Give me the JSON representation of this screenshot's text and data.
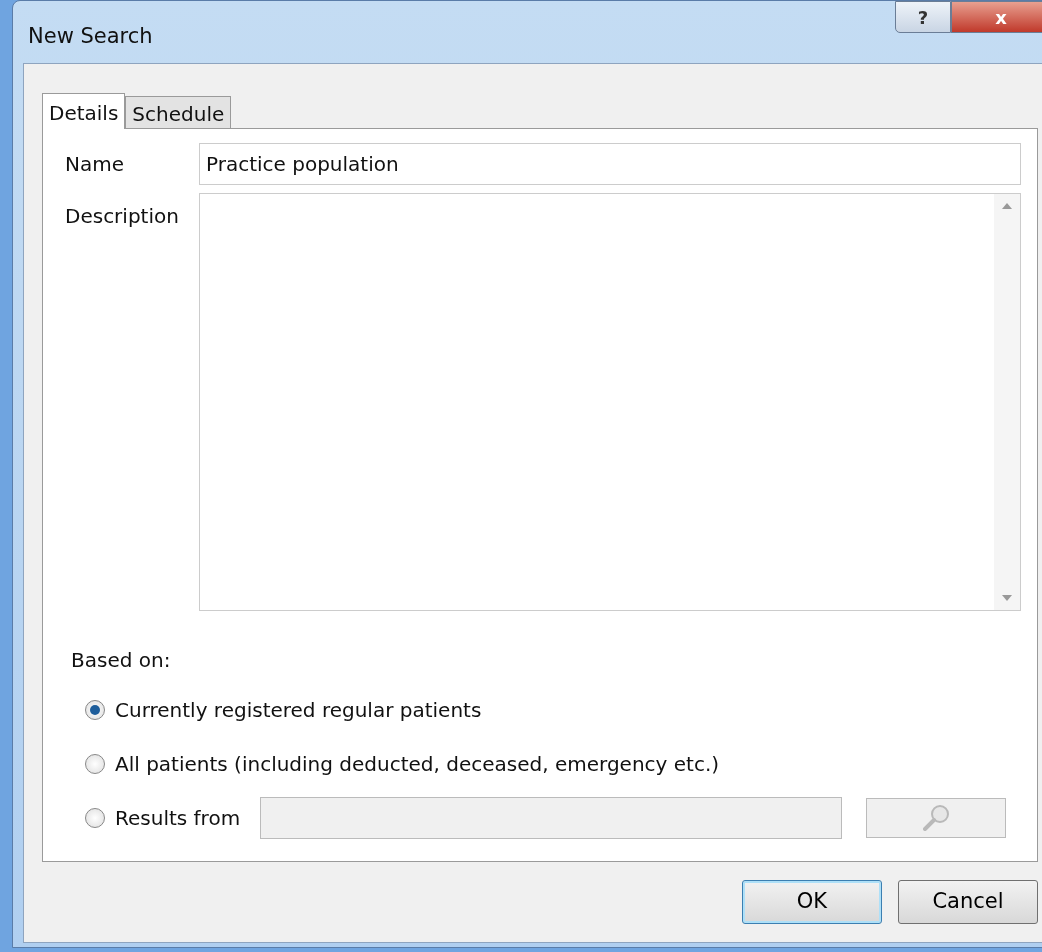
{
  "window": {
    "title": "New Search",
    "help_glyph": "?",
    "close_glyph": "x"
  },
  "tabs": [
    {
      "label": "Details",
      "selected": true
    },
    {
      "label": "Schedule",
      "selected": false
    }
  ],
  "name": {
    "label": "Name",
    "value": "Practice population"
  },
  "description": {
    "label": "Description"
  },
  "based_on": {
    "label": "Based on:",
    "options": [
      {
        "label": "Currently registered regular patients",
        "selected": true,
        "kind": "plain"
      },
      {
        "label": "All patients (including deducted, deceased, emergency etc.)",
        "selected": false,
        "kind": "plain"
      },
      {
        "label": "Results from",
        "selected": false,
        "kind": "picker",
        "disabled": true
      }
    ]
  },
  "buttons": [
    {
      "label": "OK",
      "default": true
    },
    {
      "label": "Cancel",
      "default": false
    }
  ]
}
